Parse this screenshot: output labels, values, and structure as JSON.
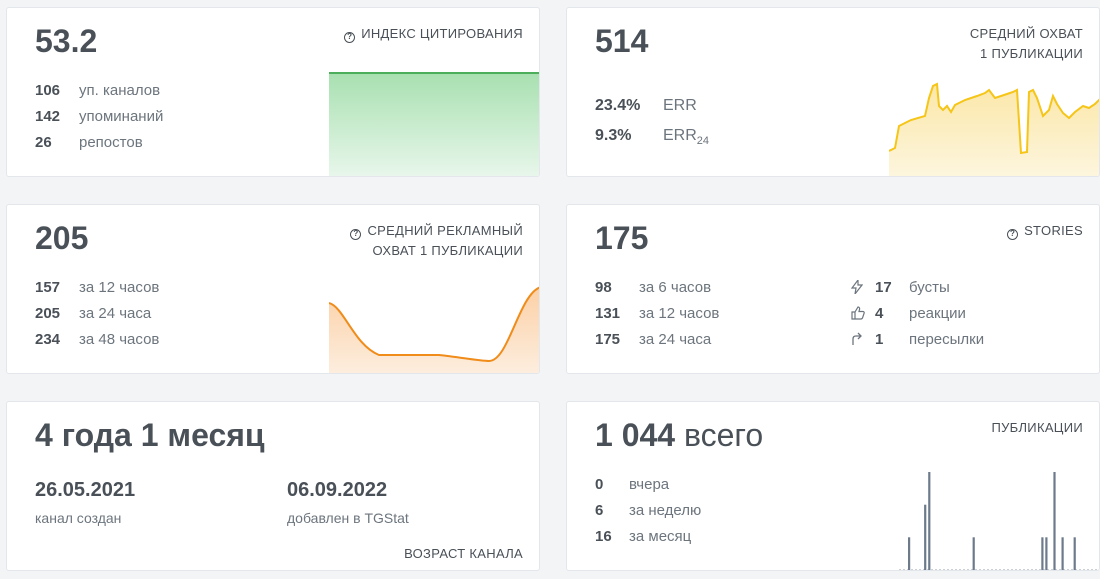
{
  "citation": {
    "value": "53.2",
    "title": "ИНДЕКС ЦИТИРОВАНИЯ",
    "stats": [
      {
        "num": "106",
        "label": "уп. каналов"
      },
      {
        "num": "142",
        "label": "упоминаний"
      },
      {
        "num": "26",
        "label": "репостов"
      }
    ]
  },
  "reach": {
    "value": "514",
    "title_line1": "СРЕДНИЙ ОХВАТ",
    "title_line2": "1 ПУБЛИКАЦИИ",
    "err_value": "23.4%",
    "err_label": "ERR",
    "err24_value": "9.3%",
    "err24_label": "ERR",
    "err24_sub": "24"
  },
  "ad_reach": {
    "value": "205",
    "title_line1": "СРЕДНИЙ РЕКЛАМНЫЙ",
    "title_line2": "ОХВАТ 1 ПУБЛИКАЦИИ",
    "stats": [
      {
        "num": "157",
        "label": "за 12 часов"
      },
      {
        "num": "205",
        "label": "за 24 часа"
      },
      {
        "num": "234",
        "label": "за 48 часов"
      }
    ]
  },
  "stories": {
    "value": "175",
    "title": "STORIES",
    "stats": [
      {
        "num": "98",
        "label": "за 6 часов"
      },
      {
        "num": "131",
        "label": "за 12 часов"
      },
      {
        "num": "175",
        "label": "за 24 часа"
      }
    ],
    "actions": [
      {
        "icon": "lightning-icon",
        "num": "17",
        "label": "бусты"
      },
      {
        "icon": "thumbs-up-icon",
        "num": "4",
        "label": "реакции"
      },
      {
        "icon": "share-arrow-icon",
        "num": "1",
        "label": "пересылки"
      }
    ]
  },
  "age": {
    "value": "4 года 1 месяц",
    "created_date": "26.05.2021",
    "created_label": "канал создан",
    "added_date": "06.09.2022",
    "added_label": "добавлен в TGStat",
    "title": "ВОЗРАСТ КАНАЛА"
  },
  "posts": {
    "value": "1 044",
    "value_suffix": "всего",
    "title": "ПУБЛИКАЦИИ",
    "stats": [
      {
        "num": "0",
        "label": "вчера"
      },
      {
        "num": "6",
        "label": "за неделю"
      },
      {
        "num": "16",
        "label": "за месяц"
      }
    ],
    "daily_counts": [
      0,
      0,
      1,
      0,
      0,
      0,
      2,
      3,
      0,
      0,
      0,
      0,
      0,
      0,
      0,
      0,
      0,
      0,
      1,
      0,
      0,
      0,
      0,
      0,
      0,
      0,
      0,
      0,
      0,
      0,
      0,
      0,
      0,
      0,
      0,
      1,
      1,
      0,
      3,
      0,
      1,
      0,
      0,
      1,
      0,
      0,
      0,
      0,
      0,
      0
    ]
  },
  "colors": {
    "green": "#5cb85c",
    "yellow": "#f5c518",
    "orange": "#f08c1a",
    "bar": "#6c7a8c"
  }
}
